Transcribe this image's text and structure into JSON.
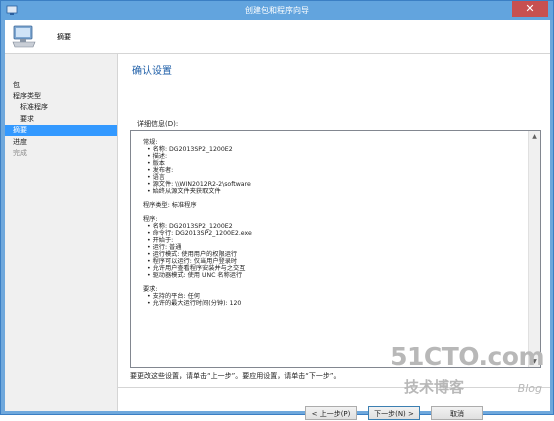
{
  "window": {
    "title": "创建包和程序向导",
    "close_glyph": "✕"
  },
  "header": {
    "title": "摘要",
    "icon": "computer-wizard-icon"
  },
  "nav": {
    "items": [
      {
        "label": "包",
        "level": 0,
        "state": "normal"
      },
      {
        "label": "程序类型",
        "level": 0,
        "state": "normal"
      },
      {
        "label": "标准程序",
        "level": 1,
        "state": "normal"
      },
      {
        "label": "要求",
        "level": 1,
        "state": "normal"
      },
      {
        "label": "摘要",
        "level": 0,
        "state": "active"
      },
      {
        "label": "进度",
        "level": 0,
        "state": "normal"
      },
      {
        "label": "完成",
        "level": 0,
        "state": "disabled"
      }
    ]
  },
  "main": {
    "section_title": "确认设置",
    "details_label": "详细信息(D):",
    "details_lines": [
      {
        "text": "常规:",
        "type": "heading"
      },
      {
        "text": "• 名称: DG2013SP2_1200E2",
        "type": "bullet"
      },
      {
        "text": "• 描述:",
        "type": "bullet"
      },
      {
        "text": "• 版本",
        "type": "bullet"
      },
      {
        "text": "• 发布者:",
        "type": "bullet"
      },
      {
        "text": "• 语言",
        "type": "bullet"
      },
      {
        "text": "• 源文件: \\\\WIN2012R2-2\\software",
        "type": "bullet"
      },
      {
        "text": "• 始终从源文件夹获取文件",
        "type": "bullet"
      },
      {
        "text": "",
        "type": "gap"
      },
      {
        "text": "程序类型: 标准程序",
        "type": "heading"
      },
      {
        "text": "",
        "type": "gap"
      },
      {
        "text": "程序:",
        "type": "heading"
      },
      {
        "text": "• 名称: DG2013SP2_1200E2",
        "type": "bullet"
      },
      {
        "text": "• 命令行: DG2013SP2_1200E2.exe",
        "type": "bullet"
      },
      {
        "text": "• 开始于:",
        "type": "bullet"
      },
      {
        "text": "• 运行: 普通",
        "type": "bullet"
      },
      {
        "text": "• 运行模式: 使用用户的权限运行",
        "type": "bullet"
      },
      {
        "text": "• 程序可以运行: 仅当用户登录时",
        "type": "bullet"
      },
      {
        "text": "• 允许用户查看程序安装并与之交互",
        "type": "bullet"
      },
      {
        "text": "• 驱动器模式: 使用 UNC 名称运行",
        "type": "bullet"
      },
      {
        "text": "",
        "type": "gap"
      },
      {
        "text": "要求:",
        "type": "heading"
      },
      {
        "text": "• 支持的平台: 任何",
        "type": "bullet"
      },
      {
        "text": "• 允许的最大运行时间(分钟): 120",
        "type": "bullet"
      }
    ],
    "hint": "要更改这些设置，请单击“上一步”。要应用设置，请单击“下一步”。"
  },
  "buttons": {
    "previous": "< 上一步(P)",
    "next": "下一步(N) >",
    "cancel": "取消"
  },
  "watermark": {
    "site": "51CTO.com",
    "cn": "技术博客",
    "blog": "Blog"
  },
  "colors": {
    "titlebar": "#62a4de",
    "active_nav": "#3399ff",
    "section_title": "#1f5fa8",
    "close_button": "#c75050"
  }
}
